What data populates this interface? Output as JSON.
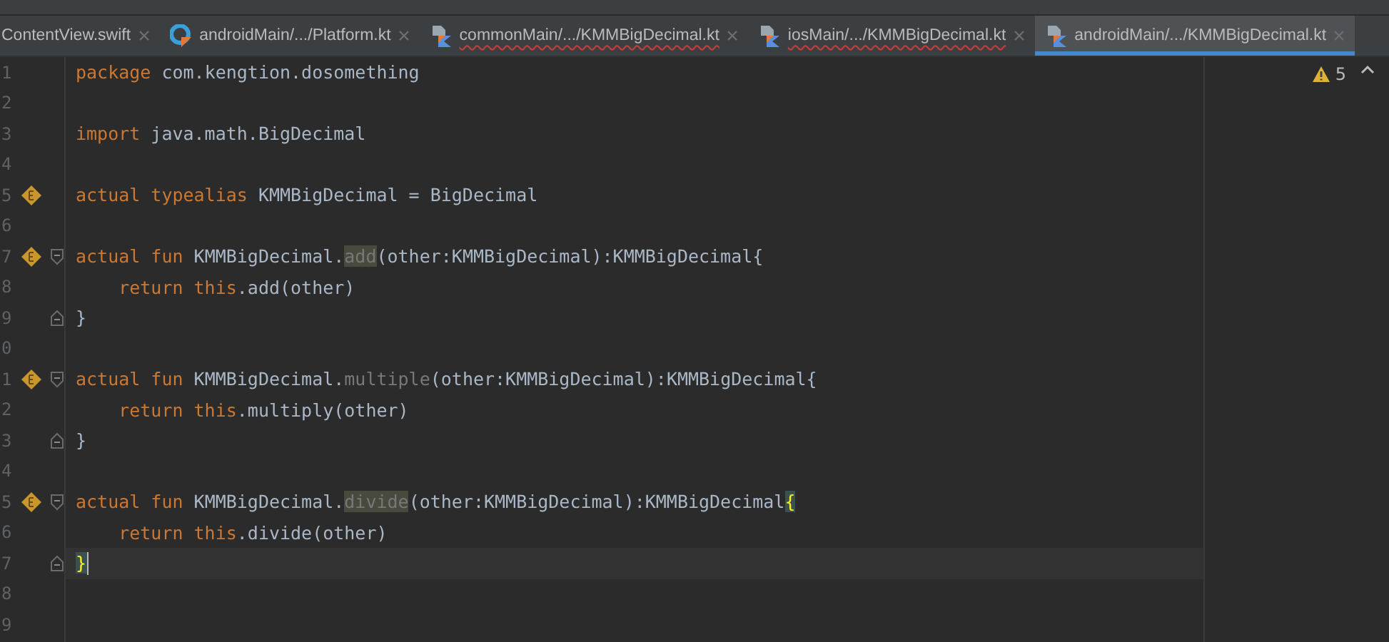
{
  "tabs": [
    {
      "label": "ContentView.swift",
      "kind": "plain",
      "selected": false,
      "has_errors": false
    },
    {
      "label": "androidMain/.../Platform.kt",
      "kind": "android",
      "selected": false,
      "has_errors": false
    },
    {
      "label": "commonMain/.../KMMBigDecimal.kt",
      "kind": "kotlin",
      "selected": false,
      "has_errors": true
    },
    {
      "label": "iosMain/.../KMMBigDecimal.kt",
      "kind": "kotlin",
      "selected": false,
      "has_errors": true
    },
    {
      "label": "androidMain/.../KMMBigDecimal.kt",
      "kind": "kotlin",
      "selected": true,
      "has_errors": false
    }
  ],
  "inspections": {
    "warnings": "5"
  },
  "lines": [
    {
      "number": "1",
      "marker": false,
      "fold_start": false,
      "fold_end": false,
      "current": false,
      "tokens": [
        {
          "text": "package",
          "kind": "kw"
        },
        {
          "text": " com.kengtion.dosomething",
          "kind": "plain"
        }
      ]
    },
    {
      "number": "2",
      "marker": false,
      "fold_start": false,
      "fold_end": false,
      "current": false
    },
    {
      "number": "3",
      "marker": false,
      "fold_start": false,
      "fold_end": false,
      "current": false,
      "tokens": [
        {
          "text": "import",
          "kind": "kw"
        },
        {
          "text": " java.math.BigDecimal",
          "kind": "plain"
        }
      ]
    },
    {
      "number": "4",
      "marker": false,
      "fold_start": false,
      "fold_end": false,
      "current": false
    },
    {
      "number": "5",
      "marker": true,
      "fold_start": false,
      "fold_end": false,
      "current": false,
      "tokens": [
        {
          "text": "actual typealias",
          "kind": "kw"
        },
        {
          "text": " KMMBigDecimal = BigDecimal",
          "kind": "plain"
        }
      ]
    },
    {
      "number": "6",
      "marker": false,
      "fold_start": false,
      "fold_end": false,
      "current": false
    },
    {
      "number": "7",
      "marker": true,
      "fold_start": true,
      "fold_end": false,
      "current": false,
      "tokens": [
        {
          "text": "actual fun",
          "kind": "kw"
        },
        {
          "text": " KMMBigDecimal.",
          "kind": "plain"
        },
        {
          "text": "add",
          "kind": "unused-hl"
        },
        {
          "text": "(other:KMMBigDecimal):KMMBigDecimal{",
          "kind": "plain"
        }
      ]
    },
    {
      "number": "8",
      "marker": false,
      "fold_start": false,
      "fold_end": false,
      "current": false,
      "tokens": [
        {
          "text": "    return this",
          "kind": "kw"
        },
        {
          "text": ".add(other)",
          "kind": "plain"
        }
      ]
    },
    {
      "number": "9",
      "marker": false,
      "fold_start": false,
      "fold_end": true,
      "current": false,
      "tokens": [
        {
          "text": "}",
          "kind": "plain"
        }
      ]
    },
    {
      "number": "0",
      "marker": false,
      "fold_start": false,
      "fold_end": false,
      "current": false
    },
    {
      "number": "1",
      "marker": true,
      "fold_start": true,
      "fold_end": false,
      "current": false,
      "tokens": [
        {
          "text": "actual fun",
          "kind": "kw"
        },
        {
          "text": " KMMBigDecimal.",
          "kind": "plain"
        },
        {
          "text": "multiple",
          "kind": "unused"
        },
        {
          "text": "(other:KMMBigDecimal):KMMBigDecimal{",
          "kind": "plain"
        }
      ]
    },
    {
      "number": "2",
      "marker": false,
      "fold_start": false,
      "fold_end": false,
      "current": false,
      "tokens": [
        {
          "text": "    return this",
          "kind": "kw"
        },
        {
          "text": ".multiply(other)",
          "kind": "plain"
        }
      ]
    },
    {
      "number": "3",
      "marker": false,
      "fold_start": false,
      "fold_end": true,
      "current": false,
      "tokens": [
        {
          "text": "}",
          "kind": "plain"
        }
      ]
    },
    {
      "number": "4",
      "marker": false,
      "fold_start": false,
      "fold_end": false,
      "current": false
    },
    {
      "number": "5",
      "marker": true,
      "fold_start": true,
      "fold_end": false,
      "current": false,
      "tokens": [
        {
          "text": "actual fun",
          "kind": "kw"
        },
        {
          "text": " KMMBigDecimal.",
          "kind": "plain"
        },
        {
          "text": "divide",
          "kind": "unused-hl"
        },
        {
          "text": "(other:KMMBigDecimal):KMMBigDecimal",
          "kind": "plain"
        },
        {
          "text": "{",
          "kind": "brace"
        }
      ]
    },
    {
      "number": "6",
      "marker": false,
      "fold_start": false,
      "fold_end": false,
      "current": false,
      "tokens": [
        {
          "text": "    return this",
          "kind": "kw"
        },
        {
          "text": ".divide(other)",
          "kind": "plain"
        }
      ]
    },
    {
      "number": "7",
      "marker": false,
      "fold_start": false,
      "fold_end": true,
      "current": true,
      "tokens": [
        {
          "text": "}",
          "kind": "brace"
        }
      ]
    },
    {
      "number": "8",
      "marker": false,
      "fold_start": false,
      "fold_end": false,
      "current": false
    },
    {
      "number": "9",
      "marker": false,
      "fold_start": false,
      "fold_end": false,
      "current": false
    }
  ]
}
